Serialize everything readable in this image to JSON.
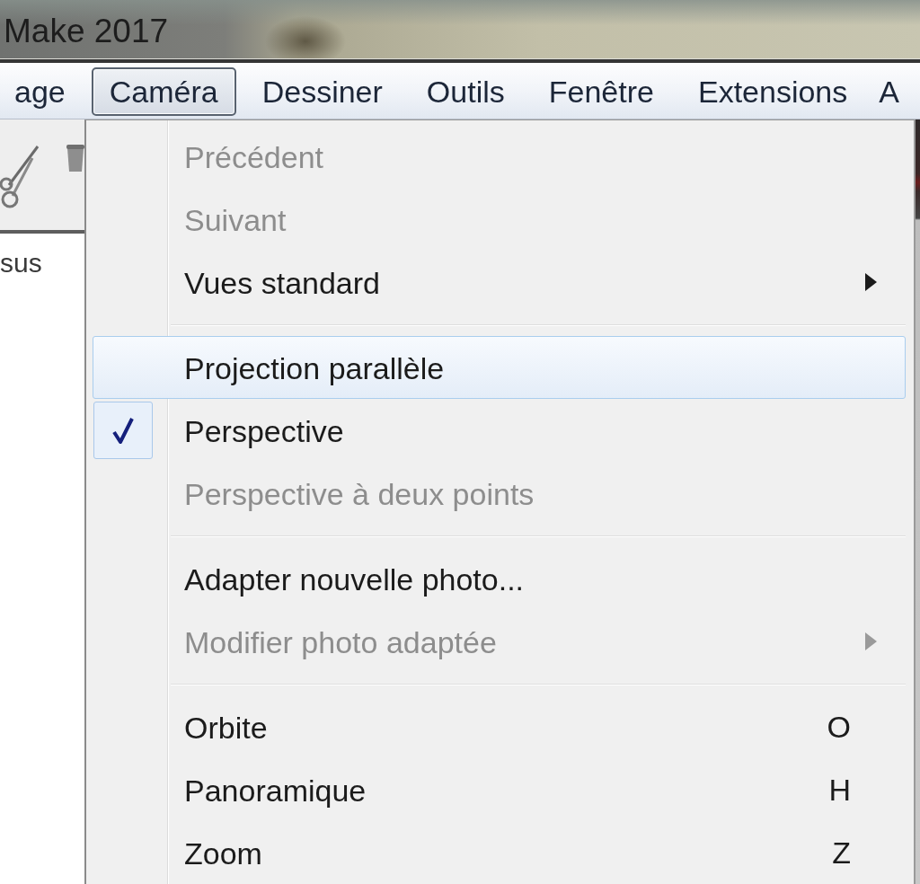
{
  "window": {
    "title": "Make 2017"
  },
  "menu_bar": [
    {
      "label": "age",
      "selected": false
    },
    {
      "label": "Caméra",
      "selected": true
    },
    {
      "label": "Dessiner",
      "selected": false
    },
    {
      "label": "Outils",
      "selected": false
    },
    {
      "label": "Fenêtre",
      "selected": false
    },
    {
      "label": "Extensions",
      "selected": false
    },
    {
      "label": "A",
      "selected": false
    }
  ],
  "side_panel": {
    "text": "sus"
  },
  "menu": {
    "items": [
      {
        "kind": "item",
        "label": "Précédent",
        "disabled": true,
        "checked": false,
        "selected": false,
        "submenu": false
      },
      {
        "kind": "item",
        "label": "Suivant",
        "disabled": true,
        "checked": false,
        "selected": false,
        "submenu": false
      },
      {
        "kind": "item",
        "label": "Vues standard",
        "disabled": false,
        "checked": false,
        "selected": false,
        "submenu": true
      },
      {
        "kind": "separator"
      },
      {
        "kind": "item",
        "label": "Projection parallèle",
        "disabled": false,
        "checked": false,
        "selected": true,
        "submenu": false
      },
      {
        "kind": "item",
        "label": "Perspective",
        "disabled": false,
        "checked": true,
        "selected": false,
        "submenu": false
      },
      {
        "kind": "item",
        "label": "Perspective à deux points",
        "disabled": true,
        "checked": false,
        "selected": false,
        "submenu": false
      },
      {
        "kind": "separator"
      },
      {
        "kind": "item",
        "label": "Adapter nouvelle photo...",
        "disabled": false,
        "checked": false,
        "selected": false,
        "submenu": false
      },
      {
        "kind": "item",
        "label": "Modifier photo adaptée",
        "disabled": true,
        "checked": false,
        "selected": false,
        "submenu": true
      },
      {
        "kind": "separator"
      },
      {
        "kind": "item",
        "label": "Orbite",
        "shortcut": "O",
        "disabled": false,
        "checked": false,
        "selected": false,
        "submenu": false
      },
      {
        "kind": "item",
        "label": "Panoramique",
        "shortcut": "H",
        "disabled": false,
        "checked": false,
        "selected": false,
        "submenu": false
      },
      {
        "kind": "item",
        "label": "Zoom",
        "shortcut": "Z",
        "disabled": false,
        "checked": false,
        "selected": false,
        "submenu": false
      }
    ]
  }
}
